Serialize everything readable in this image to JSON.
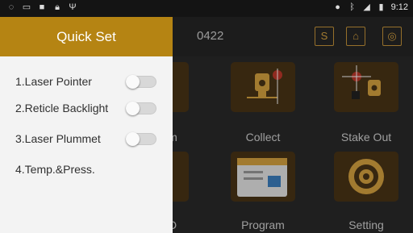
{
  "status_bar": {
    "icons_left": [
      "notification-icon",
      "image-icon",
      "square-icon",
      "lock-icon",
      "usb-icon"
    ],
    "icons_right": [
      "location-icon",
      "bluetooth-icon",
      "signal-icon",
      "battery-icon"
    ],
    "time": "9:12"
  },
  "topbar": {
    "title": "0422",
    "buttons": [
      {
        "label": "S",
        "icon": "s-button-icon"
      },
      {
        "label": "⌂",
        "icon": "home-icon"
      },
      {
        "label": "◎",
        "icon": "camera-icon"
      }
    ]
  },
  "drawer": {
    "title": "Quick Set",
    "items": [
      {
        "label": "1.Laser Pointer",
        "toggle": false
      },
      {
        "label": "2.Reticle Backlight",
        "toggle": false
      },
      {
        "label": "3.Laser Plummet",
        "toggle": false
      },
      {
        "label": "4.Temp.&Press."
      }
    ]
  },
  "grid": {
    "tiles": [
      {
        "label": "m"
      },
      {
        "label": "Collect"
      },
      {
        "label": "Stake Out"
      },
      {
        "label": "D"
      },
      {
        "label": "Program"
      },
      {
        "label": "Setting"
      }
    ]
  },
  "colors": {
    "accent": "#b58413",
    "tile_bg": "#4a3416",
    "icon_accent": "#d9a441"
  }
}
